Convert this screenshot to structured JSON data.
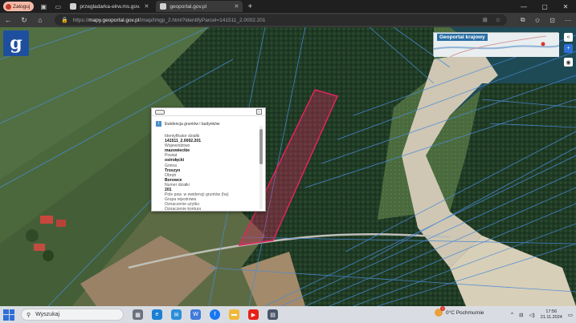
{
  "browser": {
    "profile_label": "Zaloguj",
    "tabs": [
      {
        "title": "przegladarka-elrw.ms.gov.pl/elektr...",
        "active": false
      },
      {
        "title": "geoportal.gov.pl",
        "active": true
      }
    ],
    "url": {
      "scheme": "https://",
      "host": "mapy.geoportal.gov.pl",
      "path": "/imap/Imgp_2.html?identifyParcel=141511_2.0002.201"
    }
  },
  "map": {
    "overview_title": "Geoportal krajowy",
    "logo_letter": "g"
  },
  "popup": {
    "section_title": "Ewidencja gruntów i budynków",
    "fields": [
      {
        "label": "Identyfikator działki",
        "value": "141511_2.0002.201"
      },
      {
        "label": "Województwo",
        "value": "mazowieckie"
      },
      {
        "label": "Powiat",
        "value": "ostrołęcki"
      },
      {
        "label": "Gmina",
        "value": "Troszyn"
      },
      {
        "label": "Obręb",
        "value": "Borowce"
      },
      {
        "label": "Numer działki",
        "value": "201"
      }
    ],
    "extra_labels": [
      "Pole pow. w ewidencji gruntów (ha)",
      "Grupa rejestrowa",
      "Oznaczenie użytku",
      "Oznaczenie konturu"
    ]
  },
  "taskbar": {
    "search_placeholder": "Wyszukaj",
    "weather": "0°C  Pochmurnie",
    "time": "17:56",
    "date": "21.11.2024"
  },
  "colors": {
    "accent": "#2e6fd8",
    "parcel": "#e0245e"
  }
}
